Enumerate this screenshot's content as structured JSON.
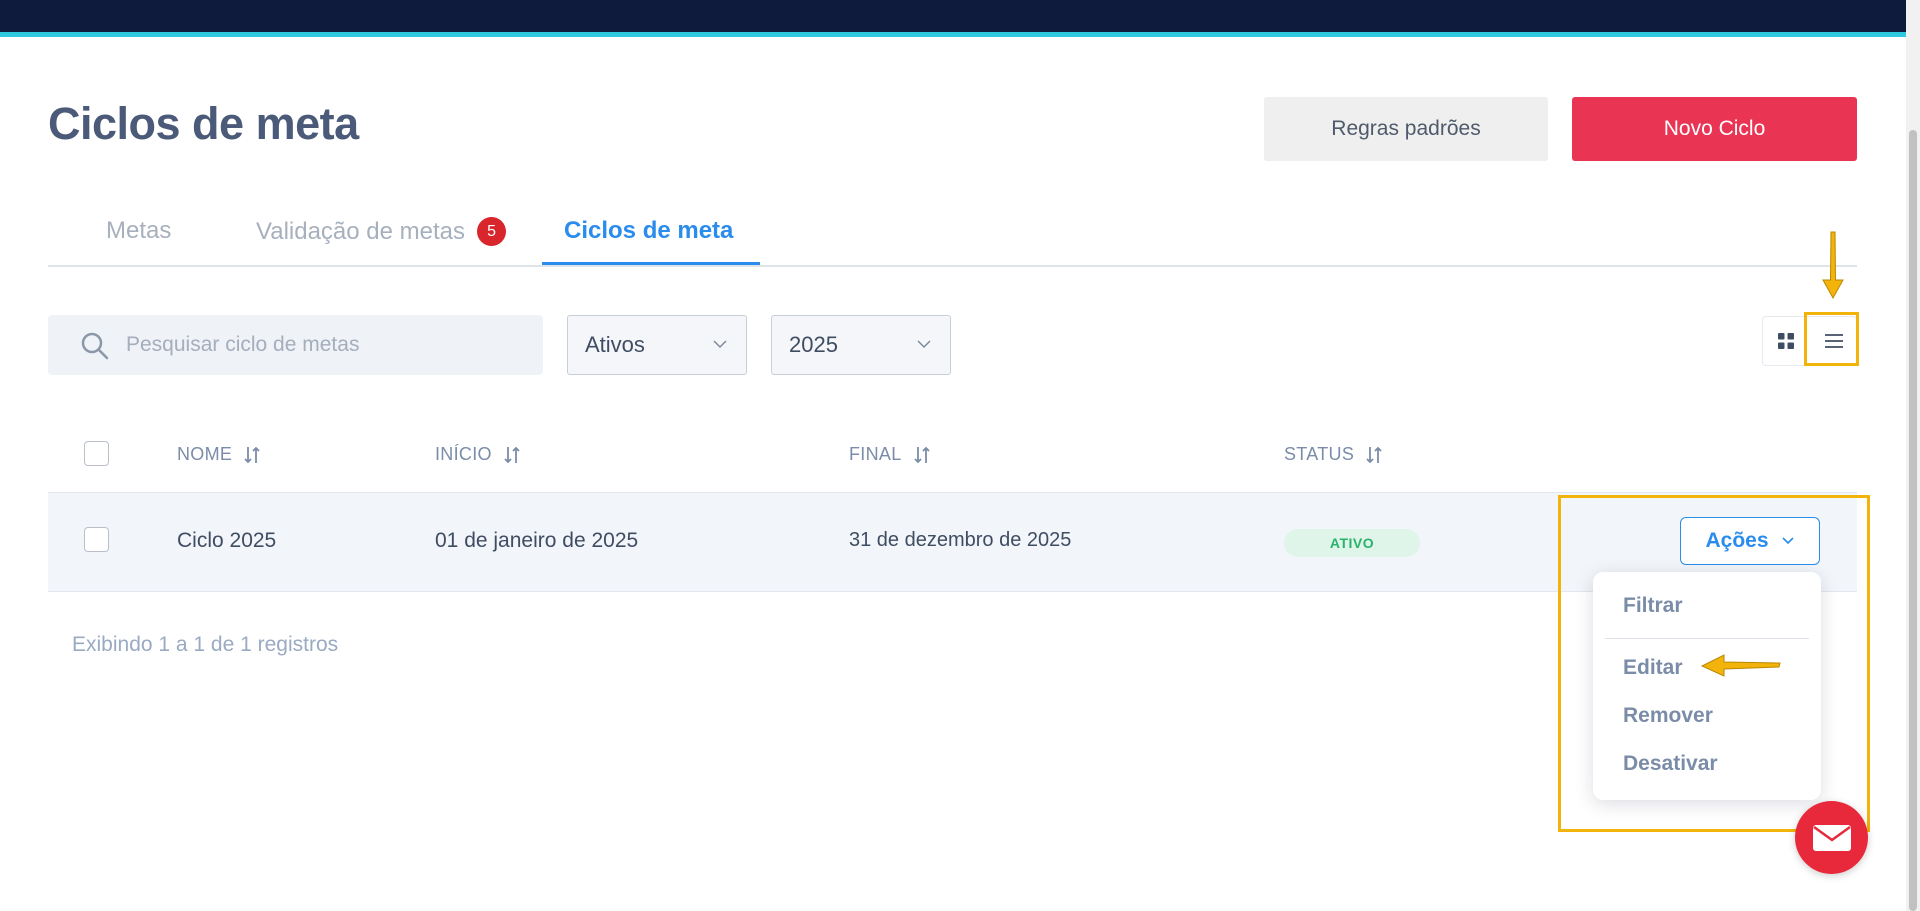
{
  "header": {
    "title": "Ciclos de meta",
    "rules_button": "Regras padrões",
    "new_button": "Novo Ciclo"
  },
  "tabs": [
    {
      "label": "Metas",
      "active": false
    },
    {
      "label": "Validação de metas",
      "badge": "5",
      "active": false
    },
    {
      "label": "Ciclos de meta",
      "active": true
    }
  ],
  "filters": {
    "search_placeholder": "Pesquisar ciclo de metas",
    "status_value": "Ativos",
    "year_value": "2025"
  },
  "table": {
    "columns": [
      "NOME",
      "INÍCIO",
      "FINAL",
      "STATUS"
    ],
    "rows": [
      {
        "nome": "Ciclo 2025",
        "inicio": "01 de janeiro de 2025",
        "final": "31 de dezembro de 2025",
        "status": "ATIVO"
      }
    ],
    "actions_label": "Ações",
    "footer": "Exibindo 1 a 1 de 1 registros"
  },
  "actions_menu": [
    "Filtrar",
    "Editar",
    "Remover",
    "Desativar"
  ],
  "icons": {
    "search": "search-icon",
    "chevron": "chevron-down-icon",
    "sort": "sort-icon",
    "grid": "grid-view-icon",
    "list": "list-view-icon",
    "mail": "mail-icon"
  },
  "colors": {
    "topbar": "#0e1b3d",
    "accent_line": "#2cc9e0",
    "primary_blue": "#2a8cec",
    "new_button": "#ea3453",
    "badge": "#d8262c",
    "status_active_bg": "#dff5ea",
    "status_active_text": "#29b36b",
    "highlight": "#f2b40a"
  }
}
